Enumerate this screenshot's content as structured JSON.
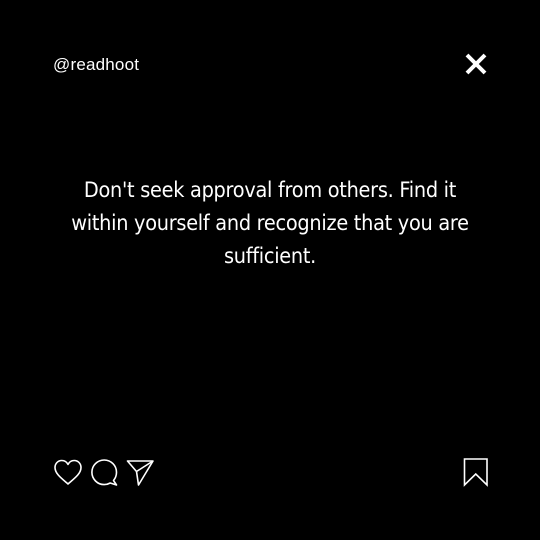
{
  "post": {
    "handle": "@readhoot",
    "quote": "Don't seek approval from others. Find it within yourself and recognize that you are sufficient.",
    "background_color": "#000000",
    "text_color": "#ffffff"
  },
  "icons": {
    "close": "close-icon",
    "like": "heart-icon",
    "comment": "comment-bubble-icon",
    "share": "paper-plane-icon",
    "save": "bookmark-icon"
  }
}
